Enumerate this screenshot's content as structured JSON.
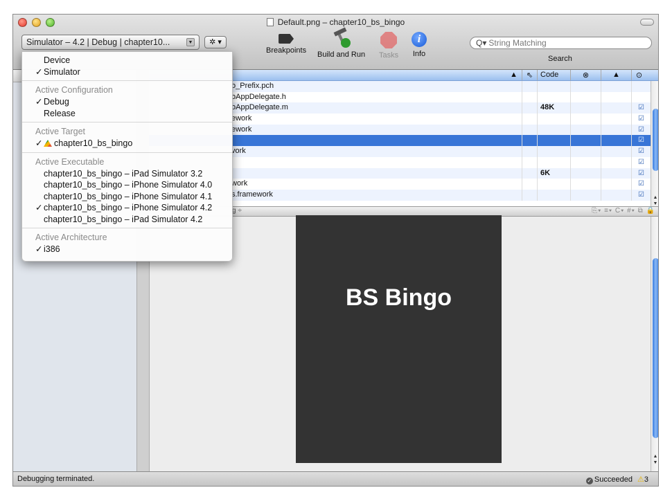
{
  "window": {
    "title": "Default.png – chapter10_bs_bingo"
  },
  "toolbar": {
    "scheme_popup": "Simulator – 4.2 | Debug | chapter10...",
    "gear_symbol": "✲",
    "breakpoints_label": "Breakpoints",
    "build_and_run_label": "Build and Run",
    "tasks_label": "Tasks",
    "info_label": "Info",
    "search_placeholder": "String Matching",
    "search_label": "Search"
  },
  "filelist": {
    "columns": {
      "build": "⇖",
      "code": "Code",
      "errors": "⊗",
      "warnings": "▲",
      "target": "⊙"
    },
    "rows": [
      {
        "name": "o_Prefix.pch",
        "code": "",
        "target": ""
      },
      {
        "name": "oAppDelegate.h",
        "code": "",
        "target": ""
      },
      {
        "name": "oAppDelegate.m",
        "code": "48K",
        "target": "☑"
      },
      {
        "name": "ework",
        "code": "",
        "target": "☑"
      },
      {
        "name": "ework",
        "code": "",
        "target": "☑"
      },
      {
        "name": "",
        "code": "",
        "target": "☑",
        "selected": true
      },
      {
        "name": "vork",
        "code": "",
        "target": "☑"
      },
      {
        "name": "",
        "code": "",
        "target": "☑"
      },
      {
        "name": "",
        "code": "6K",
        "target": "☑"
      },
      {
        "name": "work",
        "code": "",
        "target": "☑"
      },
      {
        "name": "s.framework",
        "code": "",
        "target": "☑"
      }
    ]
  },
  "navbar": {
    "left": "g ÷",
    "right": "⎘▾ ≡▾ C▾ #▾ ⧉ 🔒"
  },
  "editor": {
    "image_text": "BS Bingo",
    "image_bg": "#333333"
  },
  "status": {
    "message": "Debugging terminated.",
    "result": "Succeeded",
    "warning_count": "3"
  },
  "menu": {
    "device_label": "Device",
    "simulator_label": "Simulator",
    "config_header": "Active Configuration",
    "debug_label": "Debug",
    "release_label": "Release",
    "target_header": "Active Target",
    "target_name": "chapter10_bs_bingo",
    "executable_header": "Active Executable",
    "executables": [
      "chapter10_bs_bingo – iPad Simulator 3.2",
      "chapter10_bs_bingo – iPhone Simulator 4.0",
      "chapter10_bs_bingo – iPhone Simulator 4.1",
      "chapter10_bs_bingo – iPhone Simulator 4.2",
      "chapter10_bs_bingo – iPad Simulator 4.2"
    ],
    "arch_header": "Active Architecture",
    "arch_name": "i386",
    "check": "✓"
  }
}
